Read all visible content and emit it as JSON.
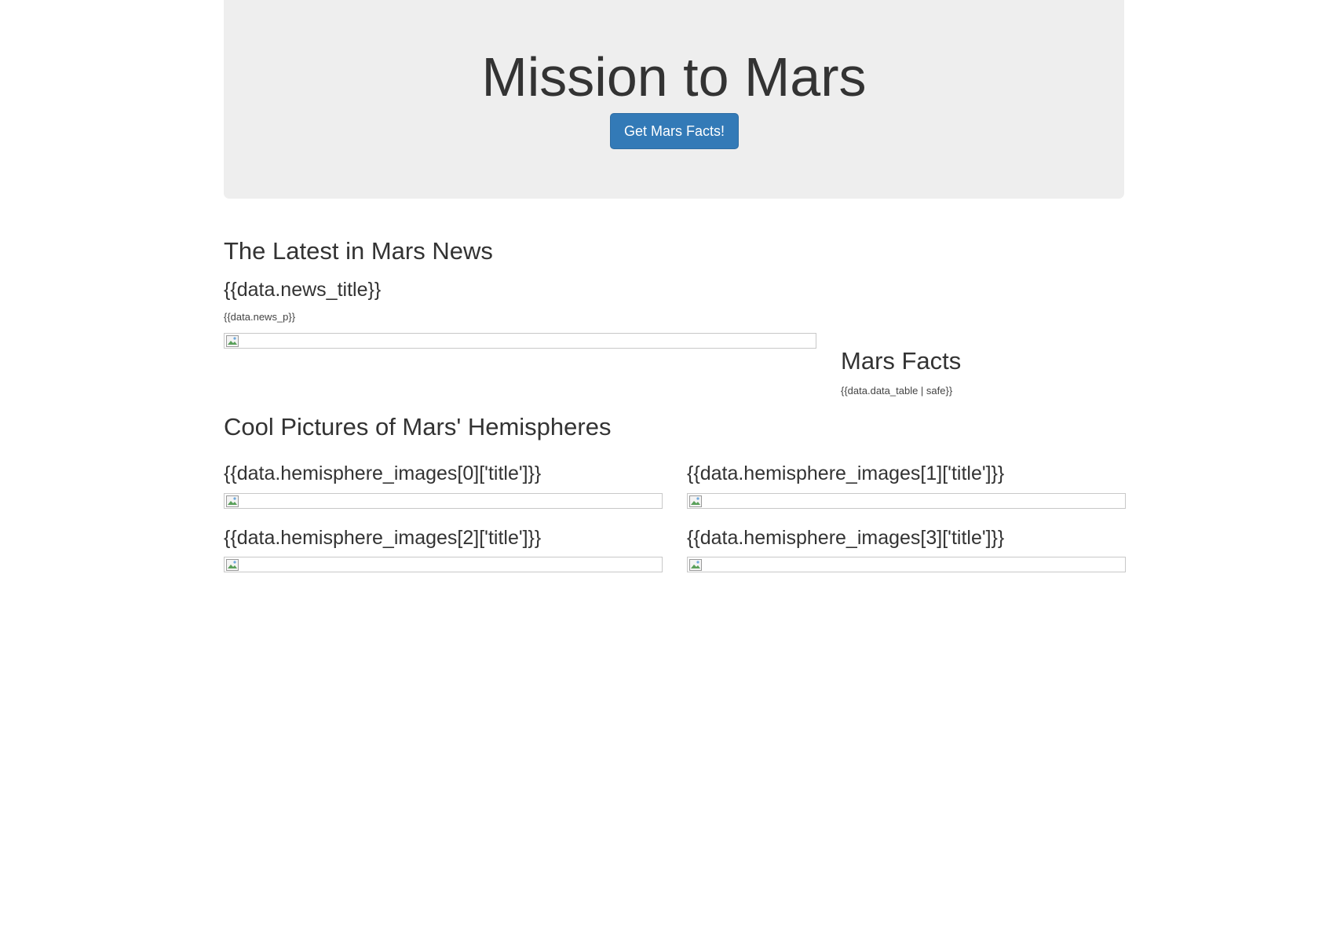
{
  "header": {
    "title": "Mission to Mars",
    "button_label": "Get Mars Facts!"
  },
  "news": {
    "heading": "The Latest in Mars News",
    "title": "{{data.news_title}}",
    "paragraph": "{{data.news_p}}",
    "image_icon": "broken-image-icon"
  },
  "facts": {
    "heading": "Mars Facts",
    "table": "{{data.data_table | safe}}"
  },
  "hemispheres": {
    "heading": "Cool Pictures of Mars' Hemispheres",
    "items": [
      {
        "title": "{{data.hemisphere_images[0]['title']}}"
      },
      {
        "title": "{{data.hemisphere_images[1]['title']}}"
      },
      {
        "title": "{{data.hemisphere_images[2]['title']}}"
      },
      {
        "title": "{{data.hemisphere_images[3]['title']}}"
      }
    ]
  },
  "colors": {
    "primary_button": "#337ab7",
    "jumbotron_bg": "#eeeeee",
    "text": "#333333"
  }
}
